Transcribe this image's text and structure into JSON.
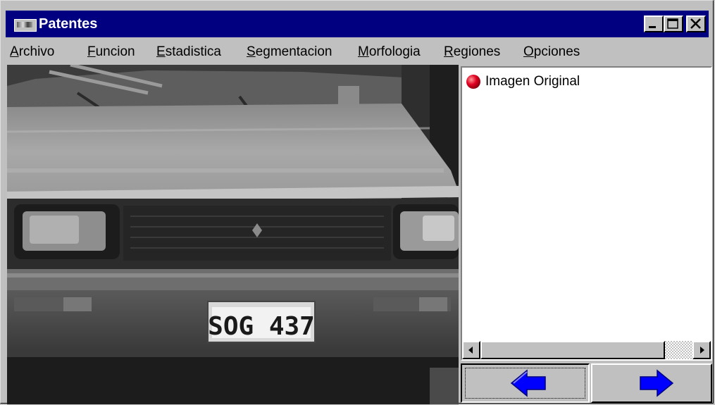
{
  "window": {
    "title": "Patentes",
    "icon": "app-icon"
  },
  "menu": [
    {
      "accel": "A",
      "rest": "rchivo"
    },
    {
      "accel": "F",
      "rest": "uncion"
    },
    {
      "accel": "E",
      "rest": "stadistica"
    },
    {
      "accel": "S",
      "rest": "egmentacion"
    },
    {
      "accel": "M",
      "rest": "orfologia"
    },
    {
      "accel": "R",
      "rest": "egiones"
    },
    {
      "accel": "O",
      "rest": "pciones"
    }
  ],
  "image": {
    "plate_text": "SOG 437"
  },
  "list": {
    "items": [
      {
        "label": "Imagen Original",
        "icon": "red-sphere-icon"
      }
    ]
  },
  "nav": {
    "back_icon": "left-arrow-icon",
    "forward_icon": "right-arrow-icon",
    "arrow_color": "#0000ff"
  },
  "colors": {
    "titlebar": "#000080",
    "face": "#c0c0c0"
  }
}
